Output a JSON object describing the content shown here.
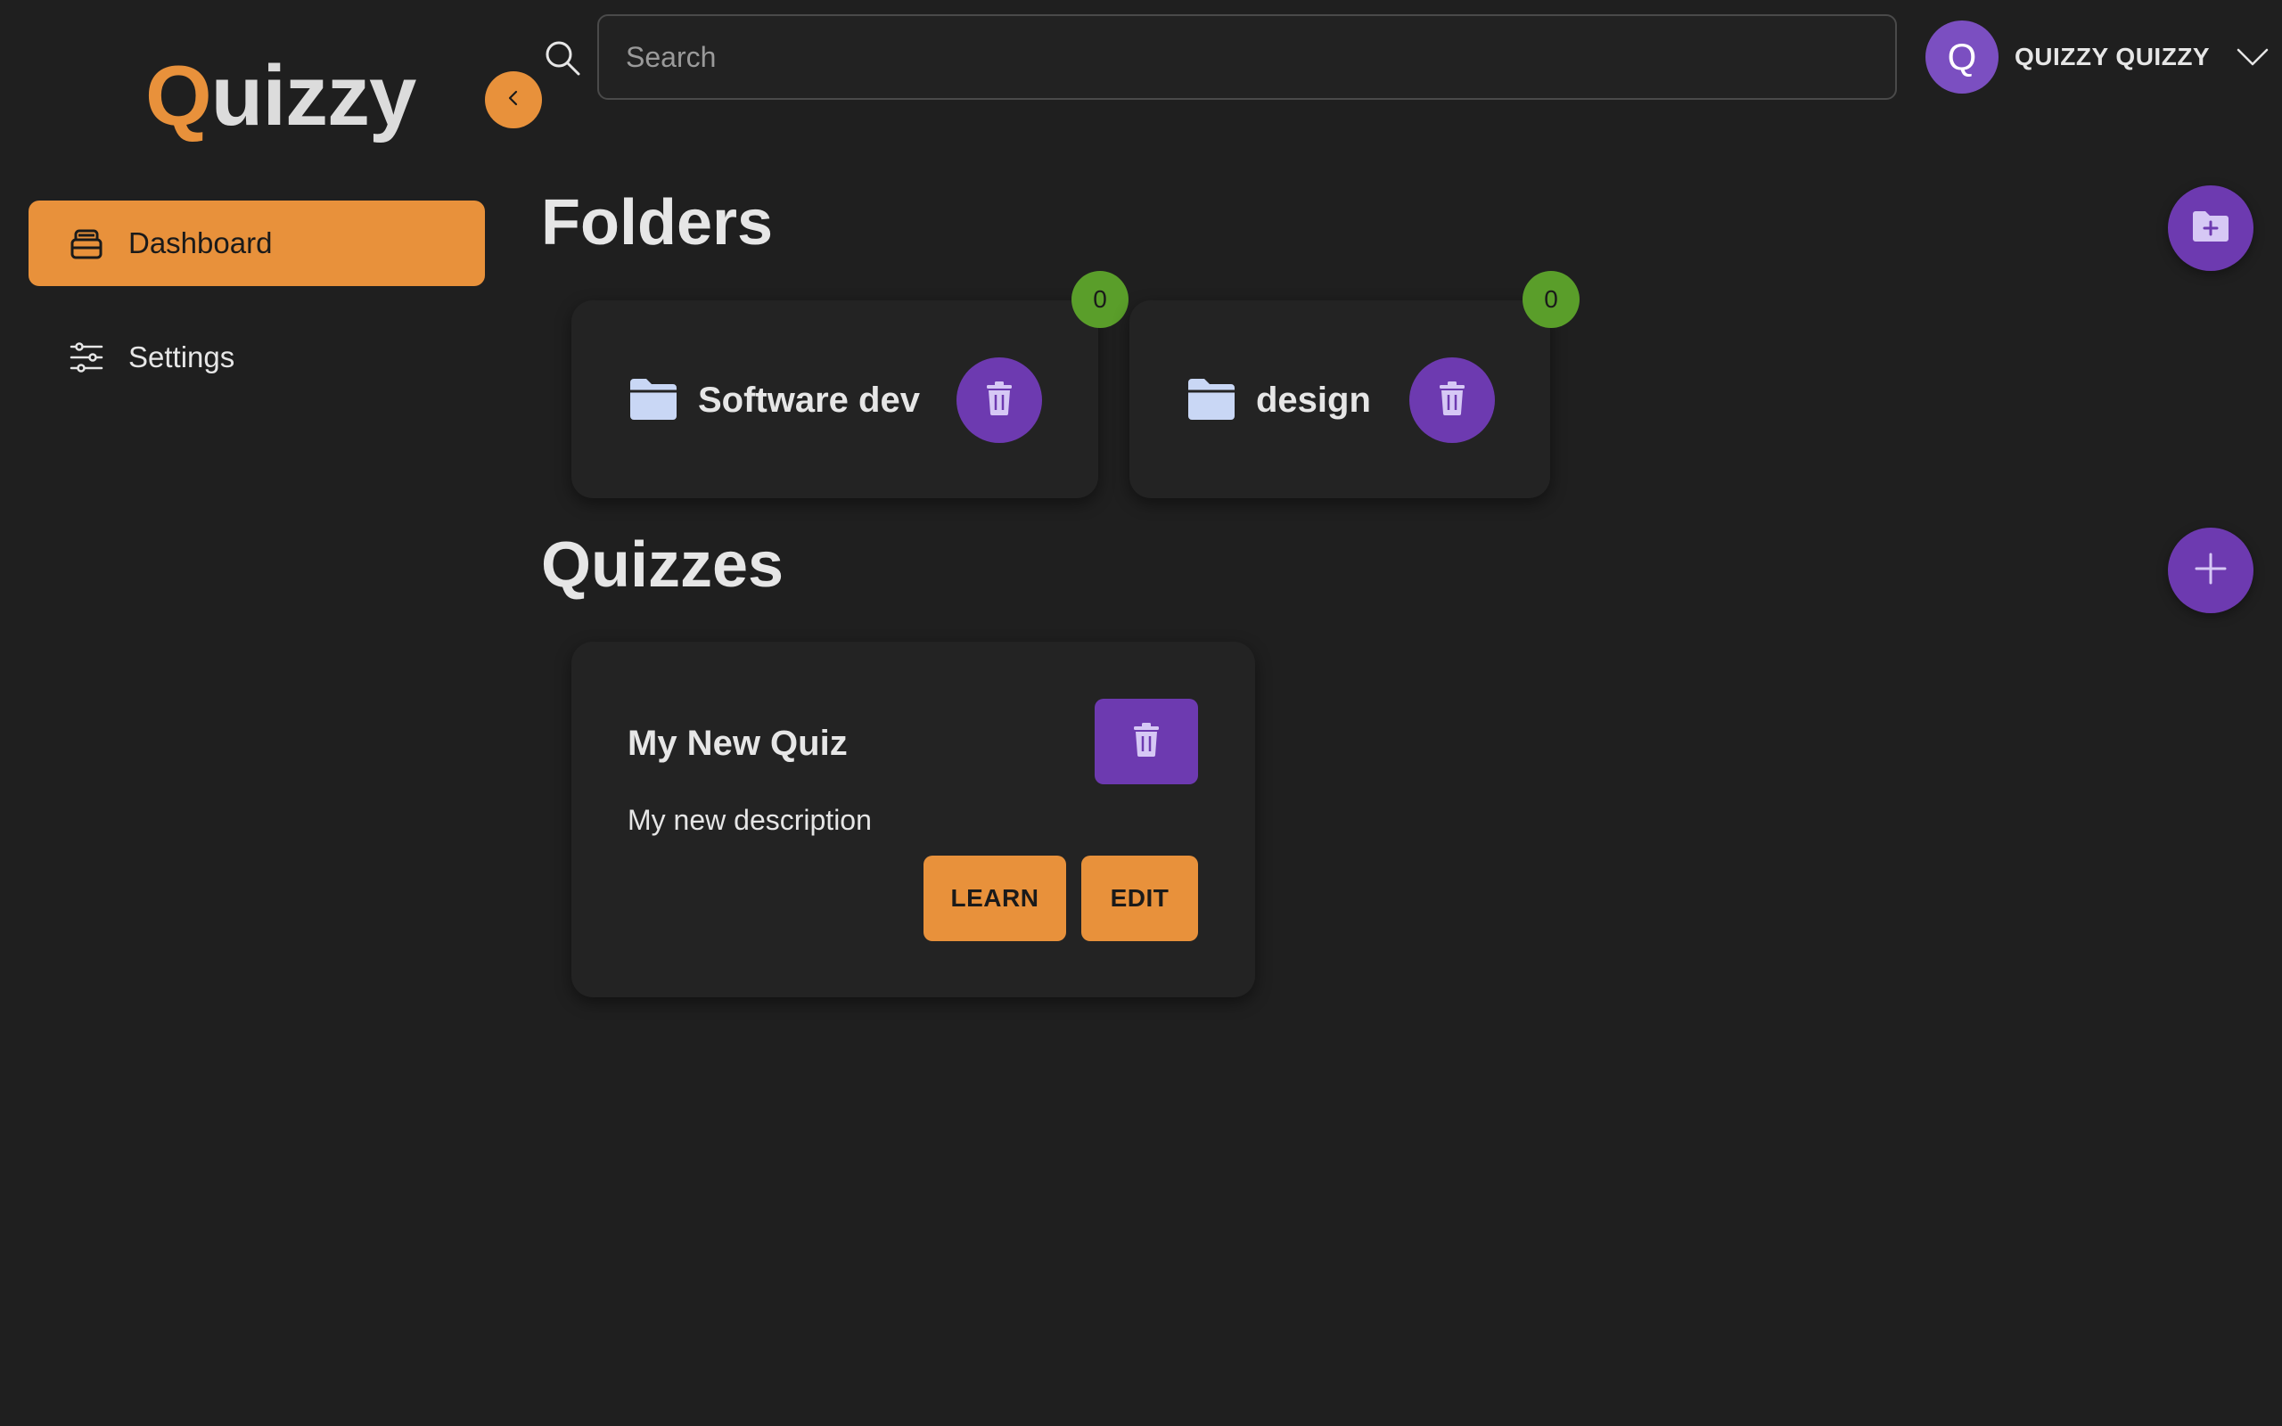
{
  "app": {
    "logo_first": "Q",
    "logo_rest": "uizzy",
    "accent_color": "#e8913b",
    "primary_color": "#6d3ab0"
  },
  "sidebar": {
    "items": [
      {
        "label": "Dashboard",
        "icon": "stack-icon",
        "active": true
      },
      {
        "label": "Settings",
        "icon": "sliders-icon",
        "active": false
      }
    ]
  },
  "search": {
    "placeholder": "Search",
    "value": ""
  },
  "user": {
    "initial": "Q",
    "name": "QUIZZY QUIZZY"
  },
  "folders": {
    "title": "Folders",
    "items": [
      {
        "name": "Software dev",
        "count": "0"
      },
      {
        "name": "design",
        "count": "0"
      }
    ]
  },
  "quizzes": {
    "title": "Quizzes",
    "items": [
      {
        "title": "My New Quiz",
        "description": "My new description",
        "learn_label": "LEARN",
        "edit_label": "EDIT"
      }
    ]
  }
}
